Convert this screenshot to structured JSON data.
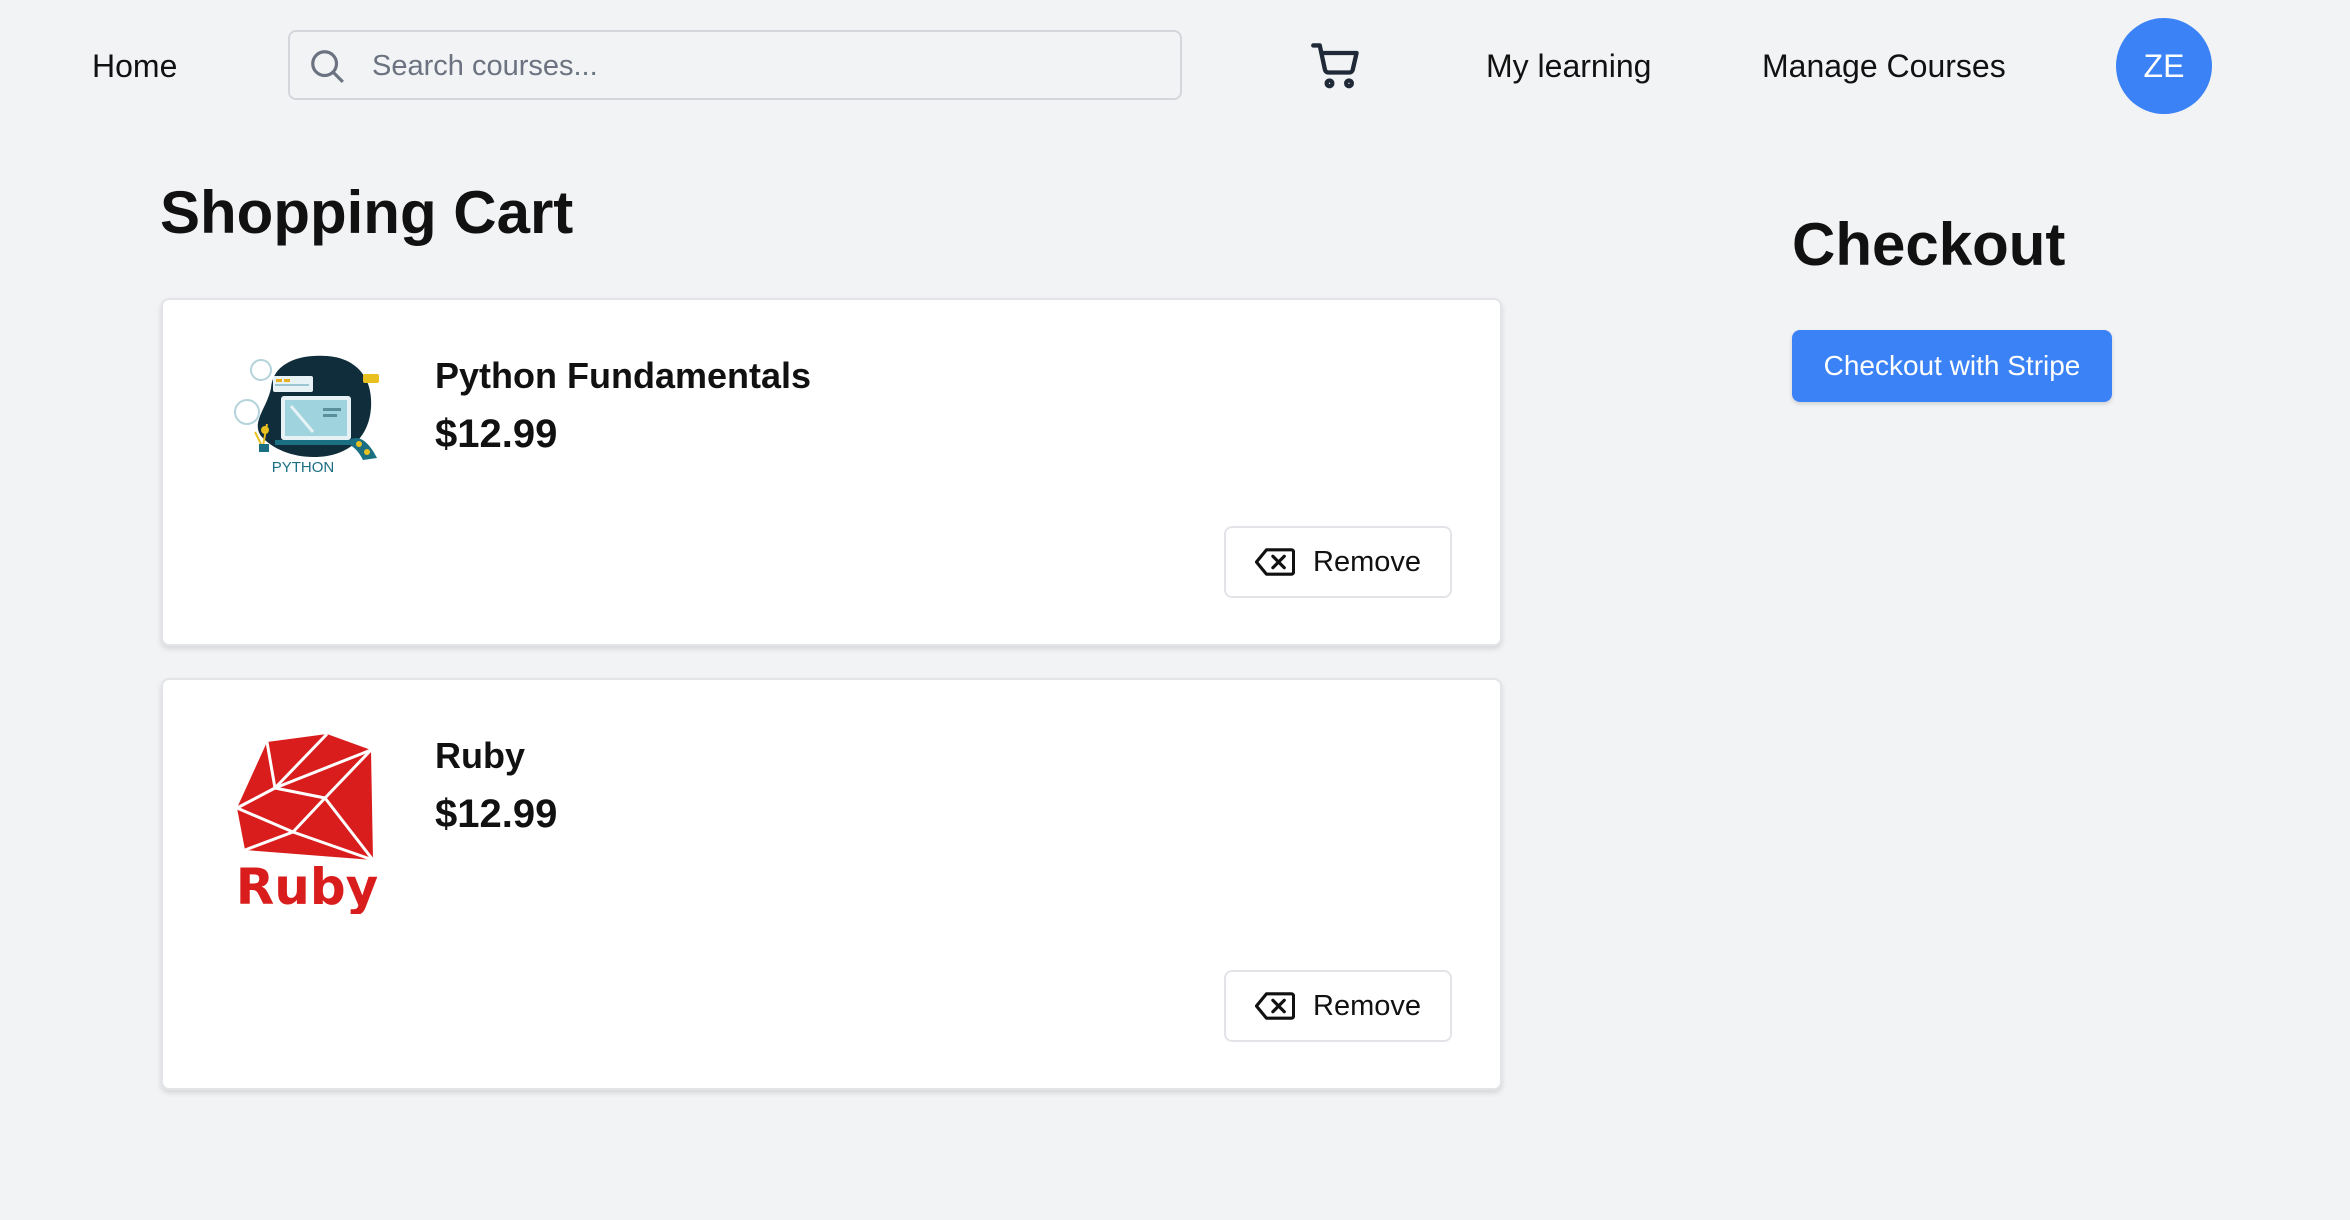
{
  "header": {
    "home_label": "Home",
    "search_placeholder": "Search courses...",
    "search_value": "",
    "cart_icon": "cart-icon",
    "my_learning_label": "My learning",
    "manage_courses_label": "Manage Courses",
    "avatar_initials": "ZE",
    "avatar_color": "#3b82f6"
  },
  "cart": {
    "title": "Shopping Cart",
    "items": [
      {
        "title": "Python Fundamentals",
        "price": "$12.99",
        "thumbnail": "python-thumbnail",
        "thumbnail_text": "PYTHON",
        "remove_label": "Remove"
      },
      {
        "title": "Ruby",
        "price": "$12.99",
        "thumbnail": "ruby-logo",
        "thumbnail_text": "Ruby",
        "remove_label": "Remove"
      }
    ]
  },
  "checkout": {
    "title": "Checkout",
    "button_label": "Checkout with Stripe",
    "button_color": "#3b82f6"
  }
}
